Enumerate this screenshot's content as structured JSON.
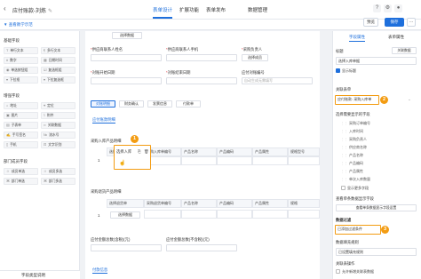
{
  "header": {
    "back_icon": "arrow-left-icon",
    "title": "应付账款-刘炼",
    "edit_icon": "pencil-icon",
    "tabs": [
      {
        "label": "表单设计",
        "active": true
      },
      {
        "label": "扩展功能",
        "active": false
      },
      {
        "label": "表单发布",
        "active": false
      },
      {
        "label": "数据管理",
        "active": false
      }
    ],
    "top_icons": [
      "help-icon",
      "settings-icon",
      "user-icon"
    ]
  },
  "subbar": {
    "dev_label": "▼ 查看教学示范",
    "preview_label": "预览",
    "save_label": "保存",
    "more_label": "⋯"
  },
  "left_panel": {
    "groups": [
      {
        "title": "基础字段",
        "fields": [
          "单行文本",
          "多行文本",
          "数字",
          "日期时间",
          "单选按钮组",
          "复选框组",
          "下拉框",
          "下拉复选框"
        ]
      },
      {
        "title": "增强字段",
        "fields": [
          "地址",
          "定位",
          "图片",
          "附件",
          "子表单",
          "关联数据",
          "手写签名",
          "流水号",
          "手机",
          "文字识别"
        ]
      },
      {
        "title": "部门成员字段",
        "fields": [
          "成员单选",
          "成员多选",
          "部门单选",
          "部门多选"
        ]
      }
    ],
    "footer": "字段类型说明"
  },
  "canvas": {
    "top_select": "选择数据",
    "row1_labels": [
      "供应商联系人姓名",
      "供应商联系人手机",
      "采购负责人"
    ],
    "row1_placeholder": "选择成员",
    "row2_labels": [
      "对账开始日期",
      "对账结束日期",
      "应付对账编号"
    ],
    "row2_placeholders": [
      "",
      "",
      "自动生成无需填写"
    ],
    "chips": [
      "对账明细",
      "财务确认",
      "发票信息",
      "付款单"
    ],
    "subtab1": "应付账款明细",
    "table1": {
      "title": "采购入库产品明细",
      "columns": [
        "选择入库单",
        "采购入库单编号",
        "产品名称",
        "产品编码",
        "产品属性",
        "规格型号"
      ],
      "row_num": "1",
      "select_label": "选择入库",
      "select_icons": [
        "copy-icon",
        "delete-icon"
      ],
      "cursor_icon": "hand-pointer-icon",
      "badge": "1"
    },
    "table2": {
      "title": "采购退货产品明细",
      "columns": [
        "选择退货单",
        "采购退货单编号",
        "产品名称",
        "产品编码",
        "产品属性",
        "规格"
      ],
      "row_num": "1",
      "select_label": "选择数据"
    },
    "amount_labels": [
      "应付金额总数(含税)(元)",
      "应付金额总数(不含税)(元)"
    ],
    "subtab2": "付款信息"
  },
  "right_panel": {
    "tabs": [
      {
        "label": "字段属性",
        "active": true
      },
      {
        "label": "表单属性",
        "active": false
      }
    ],
    "title_label": "标题",
    "title_tag": "关联数据",
    "title_value": "选择入库单据",
    "show_title": "显示标题",
    "related_form_label": "关联表单",
    "related_form_value": "应付账款: 采购入库单",
    "related_badge": "2",
    "display_fields_label": "选择需要显示的字段",
    "display_fields": [
      "采购订单编号",
      "入库时间",
      "采购负责人",
      "供应商名称",
      "产品名称",
      "产品编码",
      "产品属性",
      "单次入库数量"
    ],
    "show_more": "显示更多字段",
    "detail_label": "查看单条数据显示字段",
    "detail_button": "查看单条数据显示字段设置",
    "filter_label": "数据过滤",
    "filter_value": "已添加过滤条件",
    "filter_badge": "3",
    "rule_label": "数据填充规则",
    "rule_value": "已设置填充规则",
    "op_label": "关联表操作",
    "op_option": "允许新增关联表数据"
  }
}
